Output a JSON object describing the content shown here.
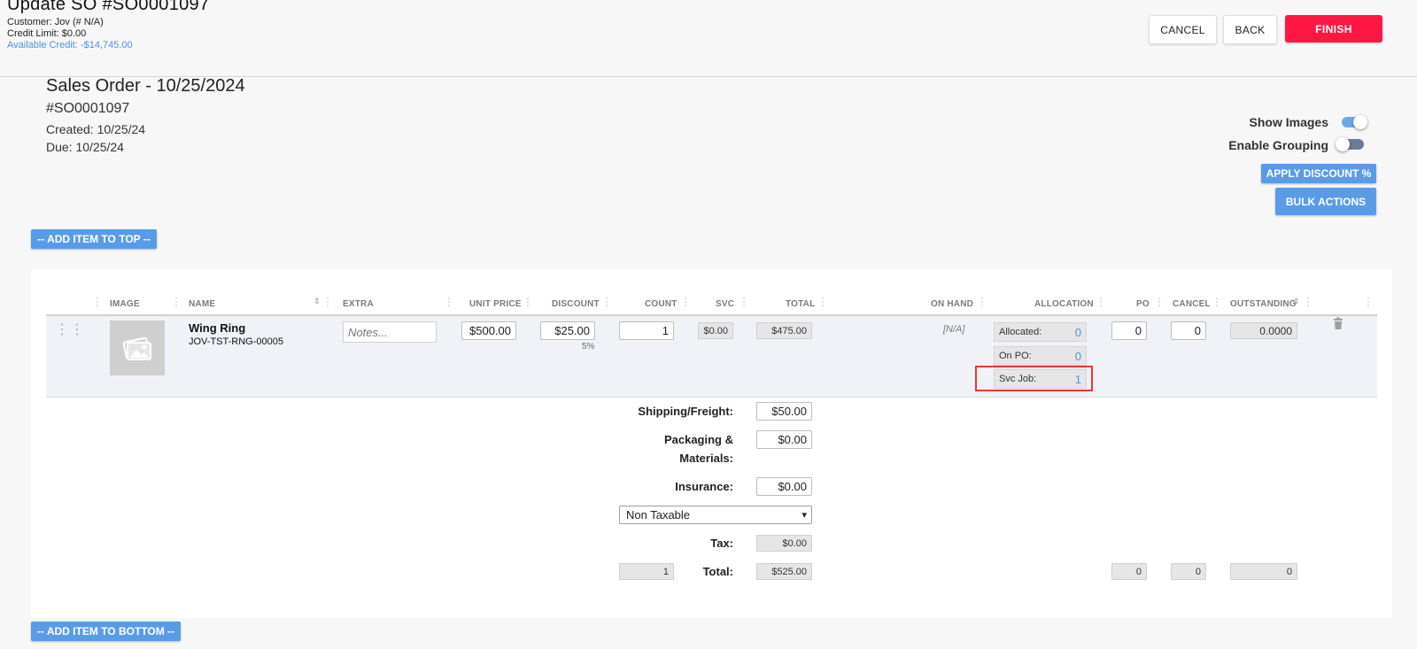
{
  "header": {
    "title": "Update SO #SO0001097",
    "customer": "Customer: Jov (# N/A)",
    "credit_limit": "Credit Limit: $0.00",
    "available_credit": "Available Credit: -$14,745.00",
    "cancel_label": "CANCEL",
    "back_label": "BACK",
    "finish_label": "FINISH"
  },
  "order": {
    "title": "Sales Order - 10/25/2024",
    "number": "#SO0001097",
    "created": "Created: 10/25/24",
    "due": "Due: 10/25/24"
  },
  "options": {
    "show_images_label": "Show Images",
    "show_images_on": true,
    "enable_grouping_label": "Enable Grouping",
    "enable_grouping_on": false,
    "apply_discount_label": "APPLY DISCOUNT %",
    "bulk_actions_label": "BULK ACTIONS"
  },
  "add_top_label": "-- ADD ITEM TO TOP --",
  "add_bottom_label": "-- ADD ITEM TO BOTTOM --",
  "columns": {
    "image": "IMAGE",
    "name": "NAME",
    "extra": "EXTRA",
    "unit_price": "UNIT PRICE",
    "discount": "DISCOUNT",
    "count": "COUNT",
    "svc": "SVC",
    "total": "TOTAL",
    "on_hand": "ON HAND",
    "allocation": "ALLOCATION",
    "po": "PO",
    "cancel": "CANCEL",
    "outstanding": "OUTSTANDING"
  },
  "row": {
    "name": "Wing Ring",
    "sku": "JOV-TST-RNG-00005",
    "notes_placeholder": "Notes...",
    "unit_price": "$500.00",
    "discount": "$25.00",
    "discount_pct": "5%",
    "count": "1",
    "svc": "$0.00",
    "total": "$475.00",
    "on_hand": "[N/A]",
    "allocated_label": "Allocated:",
    "allocated_value": "0",
    "on_po_label": "On PO:",
    "on_po_value": "0",
    "svc_job_label": "Svc Job:",
    "svc_job_value": "1",
    "po": "0",
    "cancel": "0",
    "outstanding": "0.0000"
  },
  "summary": {
    "shipping_label": "Shipping/Freight:",
    "shipping_value": "$50.00",
    "packaging_label_1": "Packaging &",
    "packaging_label_2": "Materials:",
    "packaging_value": "$0.00",
    "insurance_label": "Insurance:",
    "insurance_value": "$0.00",
    "tax_select": "Non Taxable",
    "tax_label": "Tax:",
    "tax_value": "$0.00",
    "total_label": "Total:",
    "total_count": "1",
    "total_value": "$525.00",
    "total_po": "0",
    "total_cancel": "0",
    "total_outstanding": "0"
  },
  "colors": {
    "accent_blue": "#5a9be8",
    "finish_red": "#ff1744",
    "highlight_red": "#e53935"
  }
}
